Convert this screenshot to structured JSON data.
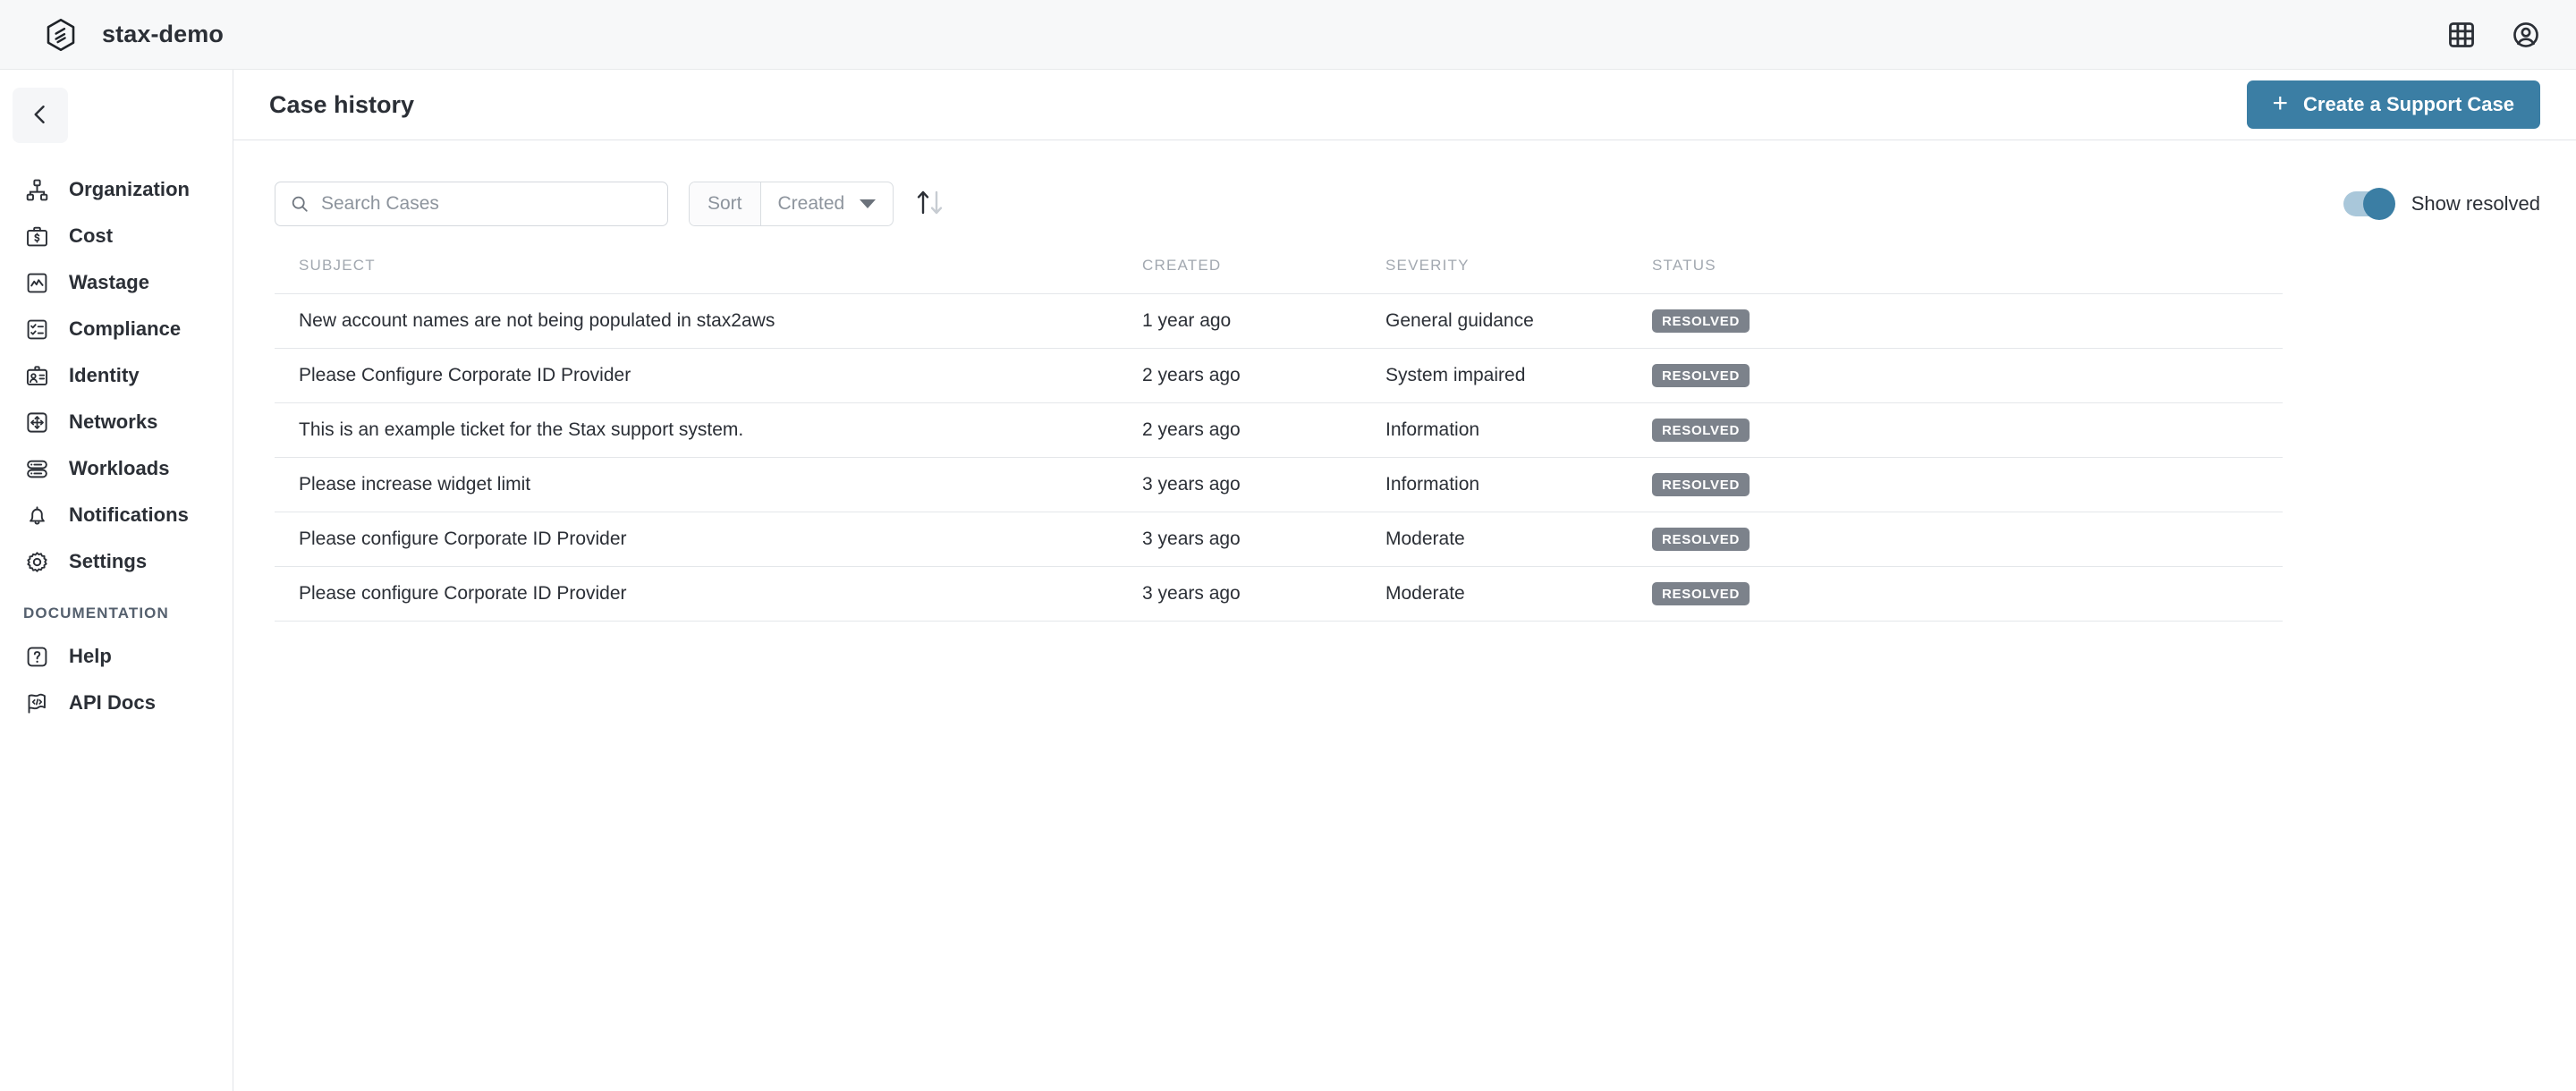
{
  "topbar": {
    "brand_name": "stax-demo",
    "logo_icon": "stax-hexagon-logo",
    "apps_icon": "grid-apps-icon",
    "account_icon": "user-account-icon"
  },
  "sidebar": {
    "collapse_icon": "chevron-left-icon",
    "items": [
      {
        "label": "Organization",
        "icon": "org-chart-icon"
      },
      {
        "label": "Cost",
        "icon": "briefcase-dollar-icon"
      },
      {
        "label": "Wastage",
        "icon": "chart-line-icon"
      },
      {
        "label": "Compliance",
        "icon": "checklist-icon"
      },
      {
        "label": "Identity",
        "icon": "id-badge-icon"
      },
      {
        "label": "Networks",
        "icon": "move-arrows-icon"
      },
      {
        "label": "Workloads",
        "icon": "server-stack-icon"
      },
      {
        "label": "Notifications",
        "icon": "bell-icon"
      },
      {
        "label": "Settings",
        "icon": "gear-icon"
      }
    ],
    "section_title": "DOCUMENTATION",
    "doc_items": [
      {
        "label": "Help",
        "icon": "question-mark-icon"
      },
      {
        "label": "API Docs",
        "icon": "code-flag-icon"
      }
    ]
  },
  "page": {
    "title": "Case history",
    "create_button": "Create a Support Case",
    "create_button_icon": "plus-icon",
    "accent_color": "#3b7ea4"
  },
  "toolbar": {
    "search_placeholder": "Search Cases",
    "search_value": "",
    "search_icon": "search-icon",
    "sort_label": "Sort",
    "sort_value": "Created",
    "sort_options": [
      "Created"
    ],
    "sort_caret_icon": "chevron-down-icon",
    "sort_direction_icon": "sort-ascending-icon",
    "toggle_label": "Show resolved",
    "toggle_on": true
  },
  "table": {
    "columns": [
      "SUBJECT",
      "CREATED",
      "SEVERITY",
      "STATUS"
    ],
    "rows": [
      {
        "subject": "New account names are not being populated in stax2aws",
        "created": "1 year ago",
        "severity": "General guidance",
        "status": "RESOLVED"
      },
      {
        "subject": "Please Configure Corporate ID Provider",
        "created": "2 years ago",
        "severity": "System impaired",
        "status": "RESOLVED"
      },
      {
        "subject": "This is an example ticket for the Stax support system.",
        "created": "2 years ago",
        "severity": "Information",
        "status": "RESOLVED"
      },
      {
        "subject": "Please increase widget limit",
        "created": "3 years ago",
        "severity": "Information",
        "status": "RESOLVED"
      },
      {
        "subject": "Please configure Corporate ID Provider",
        "created": "3 years ago",
        "severity": "Moderate",
        "status": "RESOLVED"
      },
      {
        "subject": "Please configure Corporate ID Provider",
        "created": "3 years ago",
        "severity": "Moderate",
        "status": "RESOLVED"
      }
    ]
  }
}
